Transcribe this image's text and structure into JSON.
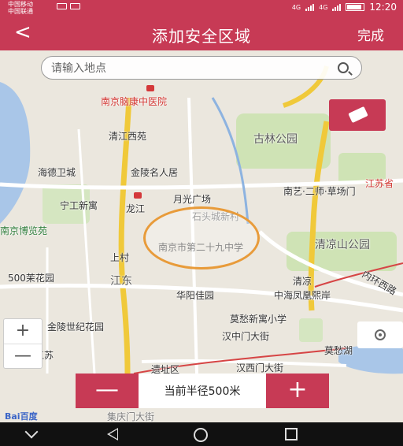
{
  "status_bar": {
    "carrier_1": "中国移动",
    "carrier_2": "中国联通",
    "time": "12:20",
    "network_1": "4G",
    "network_2": "4G"
  },
  "header": {
    "back_symbol": "<",
    "title": "添加安全区域",
    "done_label": "完成"
  },
  "search": {
    "placeholder": "请输入地点",
    "icon": "search-icon"
  },
  "map": {
    "labels": [
      "南京脑康中医院",
      "清江西苑",
      "古林公园",
      "海德卫城",
      "金陵名人居",
      "江苏省",
      "月光广场",
      "南艺·二师·草场门",
      "宁工新寓",
      "龙江",
      "石头城新村",
      "清凉山公园",
      "上村",
      "江东",
      "清凉",
      "中海凤凰熙岸",
      "内环西路",
      "华阳佳园",
      "莫愁新寓小学",
      "金陵世纪花园",
      "汉中门大街",
      "莫愁湖",
      "江苏",
      "遗址区",
      "汉西门大街",
      "集庆门大街",
      "南京博览苑",
      "500茉花园"
    ],
    "zone_label": "南京市第二十九中学",
    "eraser_icon": "eraser-icon",
    "locate_icon": "locate-icon"
  },
  "zoom": {
    "in_label": "+",
    "out_label": "—"
  },
  "radius": {
    "minus_label": "—",
    "text": "当前半径500米",
    "plus_label": "+"
  },
  "brand": "Bai百度",
  "colors": {
    "accent": "#c73a55",
    "zone": "#e89b3a",
    "major_road": "#f0c93a"
  }
}
